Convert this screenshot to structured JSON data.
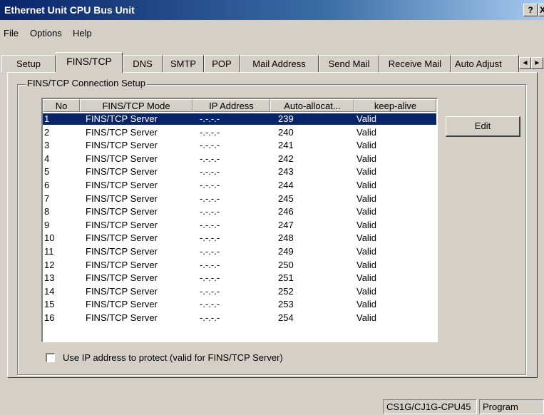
{
  "window": {
    "title": "Ethernet Unit CPU Bus Unit",
    "help_button": "?",
    "close_button": "X"
  },
  "menu": [
    "File",
    "Options",
    "Help"
  ],
  "tabs": [
    {
      "label": "Setup"
    },
    {
      "label": "FINS/TCP",
      "active": true
    },
    {
      "label": "DNS"
    },
    {
      "label": "SMTP"
    },
    {
      "label": "POP"
    },
    {
      "label": "Mail Address"
    },
    {
      "label": "Send Mail"
    },
    {
      "label": "Receive Mail"
    },
    {
      "label": "Auto Adjust"
    }
  ],
  "tab_scroll": {
    "left": "◄",
    "right": "►"
  },
  "group": {
    "legend": "FINS/TCP Connection Setup"
  },
  "table": {
    "columns": [
      "No",
      "FINS/TCP Mode",
      "IP Address",
      "Auto-allocat...",
      "keep-alive"
    ],
    "rows": [
      [
        "1",
        "FINS/TCP Server",
        "-.-.-.-",
        "239",
        "Valid"
      ],
      [
        "2",
        "FINS/TCP Server",
        "-.-.-.-",
        "240",
        "Valid"
      ],
      [
        "3",
        "FINS/TCP Server",
        "-.-.-.-",
        "241",
        "Valid"
      ],
      [
        "4",
        "FINS/TCP Server",
        "-.-.-.-",
        "242",
        "Valid"
      ],
      [
        "5",
        "FINS/TCP Server",
        "-.-.-.-",
        "243",
        "Valid"
      ],
      [
        "6",
        "FINS/TCP Server",
        "-.-.-.-",
        "244",
        "Valid"
      ],
      [
        "7",
        "FINS/TCP Server",
        "-.-.-.-",
        "245",
        "Valid"
      ],
      [
        "8",
        "FINS/TCP Server",
        "-.-.-.-",
        "246",
        "Valid"
      ],
      [
        "9",
        "FINS/TCP Server",
        "-.-.-.-",
        "247",
        "Valid"
      ],
      [
        "10",
        "FINS/TCP Server",
        "-.-.-.-",
        "248",
        "Valid"
      ],
      [
        "11",
        "FINS/TCP Server",
        "-.-.-.-",
        "249",
        "Valid"
      ],
      [
        "12",
        "FINS/TCP Server",
        "-.-.-.-",
        "250",
        "Valid"
      ],
      [
        "13",
        "FINS/TCP Server",
        "-.-.-.-",
        "251",
        "Valid"
      ],
      [
        "14",
        "FINS/TCP Server",
        "-.-.-.-",
        "252",
        "Valid"
      ],
      [
        "15",
        "FINS/TCP Server",
        "-.-.-.-",
        "253",
        "Valid"
      ],
      [
        "16",
        "FINS/TCP Server",
        "-.-.-.-",
        "254",
        "Valid"
      ]
    ],
    "selected_row": 0
  },
  "edit_button": "Edit",
  "checkbox": {
    "label": "Use IP address to protect (valid for FINS/TCP Server)",
    "checked": false
  },
  "status": {
    "cpu": "CS1G/CJ1G-CPU45",
    "mode": "Program"
  },
  "colors": {
    "selection": "#0a246a",
    "face": "#d4d0c8",
    "title_start": "#0a246a"
  }
}
